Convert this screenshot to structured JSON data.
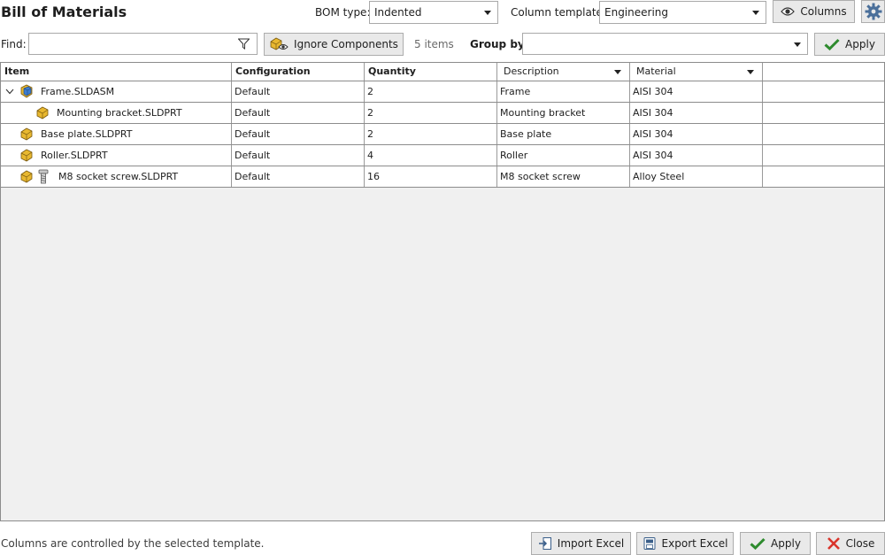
{
  "window": {
    "title": "Bill of Materials"
  },
  "toolbar": {
    "bom_type_label": "BOM type:",
    "bom_type_value": "Indented",
    "column_template_label": "Column template:",
    "column_template_value": "Engineering",
    "columns_button": "Columns"
  },
  "filter": {
    "find_label": "Find:",
    "find_value": "",
    "ignore_components_button": "Ignore Components",
    "items_count": "5 items",
    "group_by_label": "Group by:",
    "group_by_value": "",
    "apply_button": "Apply"
  },
  "table": {
    "headers": {
      "item": "Item",
      "configuration": "Configuration",
      "quantity": "Quantity",
      "description": "Description",
      "material": "Material"
    },
    "rows": [
      {
        "item": "Frame.SLDASM",
        "configuration": "Default",
        "quantity": "2",
        "description": "Frame",
        "material": "AISI 304"
      },
      {
        "item": "Mounting bracket.SLDPRT",
        "configuration": "Default",
        "quantity": "2",
        "description": "Mounting bracket",
        "material": "AISI 304"
      },
      {
        "item": "Base plate.SLDPRT",
        "configuration": "Default",
        "quantity": "2",
        "description": "Base plate",
        "material": "AISI 304"
      },
      {
        "item": "Roller.SLDPRT",
        "configuration": "Default",
        "quantity": "4",
        "description": "Roller",
        "material": "AISI 304"
      },
      {
        "item": "M8 socket screw.SLDPRT",
        "configuration": "Default",
        "quantity": "16",
        "description": "M8 socket screw",
        "material": "Alloy Steel"
      }
    ]
  },
  "footer": {
    "note": "Columns are controlled by the selected template.",
    "import_excel_button": "Import Excel",
    "export_excel_button": "Export Excel",
    "apply_button": "Apply",
    "close_button": "Close"
  },
  "colors": {
    "grid_empty": "#f0f0f0",
    "button_face": "#e9e9e9",
    "check_green": "#2e8b2e",
    "close_red": "#d9342b",
    "part_yellow": "#e8b830"
  },
  "icons": [
    "filter-icon",
    "ignore-components-icon",
    "eye-icon",
    "gear-icon",
    "check-icon",
    "close-x-icon",
    "import-excel-icon",
    "export-excel-icon",
    "assembly-icon",
    "part-icon",
    "screw-icon",
    "chevron-down-icon"
  ]
}
